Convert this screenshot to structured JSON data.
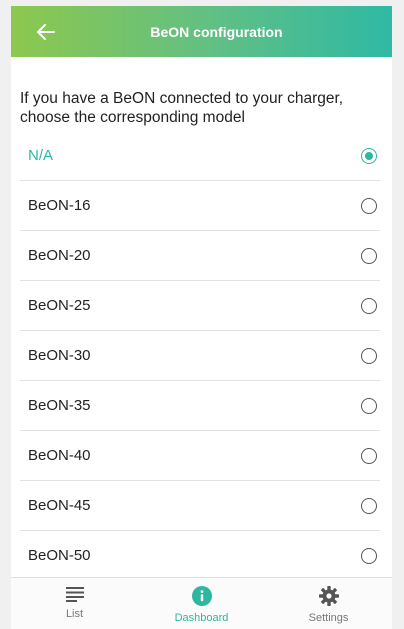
{
  "header": {
    "title": "BeON configuration"
  },
  "intro": "If you have a BeON connected to your charger, choose the corresponding model",
  "options": [
    {
      "label": "N/A",
      "selected": true
    },
    {
      "label": "BeON-16",
      "selected": false
    },
    {
      "label": "BeON-20",
      "selected": false
    },
    {
      "label": "BeON-25",
      "selected": false
    },
    {
      "label": "BeON-30",
      "selected": false
    },
    {
      "label": "BeON-35",
      "selected": false
    },
    {
      "label": "BeON-40",
      "selected": false
    },
    {
      "label": "BeON-45",
      "selected": false
    },
    {
      "label": "BeON-50",
      "selected": false
    }
  ],
  "nav": {
    "items": [
      {
        "label": "List",
        "icon": "list-icon",
        "active": false
      },
      {
        "label": "Dashboard",
        "icon": "info-icon",
        "active": true
      },
      {
        "label": "Settings",
        "icon": "gear-icon",
        "active": false
      }
    ]
  },
  "colors": {
    "accent": "#2fb6a0",
    "header_start": "#8dc84e",
    "header_end": "#2fb9a4"
  }
}
